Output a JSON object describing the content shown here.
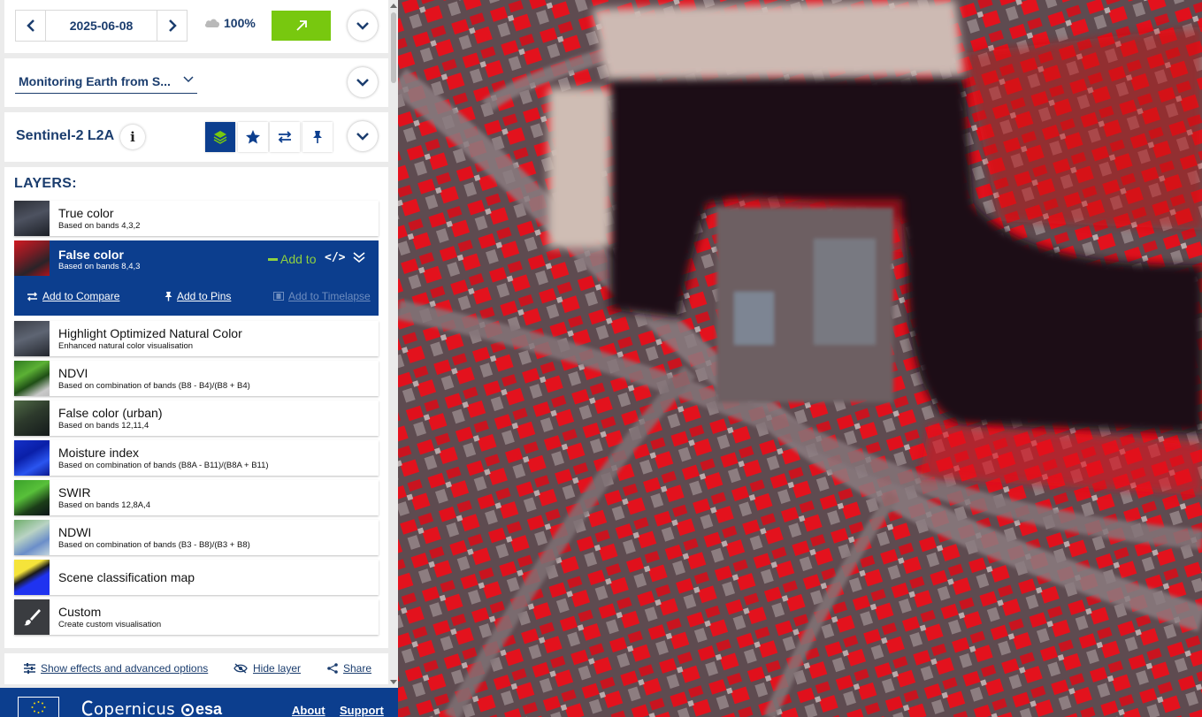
{
  "date_control": {
    "date": "2025-06-08",
    "cloud_cover": "100%"
  },
  "theme": {
    "selected": "Monitoring Earth from S..."
  },
  "datasource": {
    "name": "Sentinel-2 L2A",
    "info": "i"
  },
  "layers": {
    "title": "LAYERS:",
    "items": [
      {
        "name": "True color",
        "description": "Based on bands 4,3,2"
      },
      {
        "name": "False color",
        "description": "Based on bands 8,4,3"
      },
      {
        "name": "Highlight Optimized Natural Color",
        "description": "Enhanced natural color visualisation"
      },
      {
        "name": "NDVI",
        "description": "Based on combination of bands (B8 - B4)/(B8 + B4)"
      },
      {
        "name": "False color (urban)",
        "description": "Based on bands 12,11,4"
      },
      {
        "name": "Moisture index",
        "description": "Based on combination of bands (B8A - B11)/(B8A + B11)"
      },
      {
        "name": "SWIR",
        "description": "Based on bands 12,8A,4"
      },
      {
        "name": "NDWI",
        "description": "Based on combination of bands (B3 - B8)/(B3 + B8)"
      },
      {
        "name": "Scene classification map",
        "description": ""
      },
      {
        "name": "Custom",
        "description": "Create custom visualisation"
      }
    ],
    "active_actions": {
      "add_to": "Add to",
      "code": "</>",
      "add_to_compare": "Add to Compare",
      "add_to_pins": "Add to Pins",
      "add_to_timelapse": "Add to Timelapse"
    }
  },
  "options": {
    "effects": "Show effects and advanced options",
    "hide_layer": "Hide layer",
    "share": "Share"
  },
  "footer": {
    "copernicus": "opernicus",
    "esa": "esa",
    "about": "About",
    "support": "Support"
  },
  "colors": {
    "brand_blue": "#0c3e8e",
    "text_blue": "#1b3d6e",
    "accent_green": "#78c80f",
    "false_color_red": "#e8141e"
  }
}
